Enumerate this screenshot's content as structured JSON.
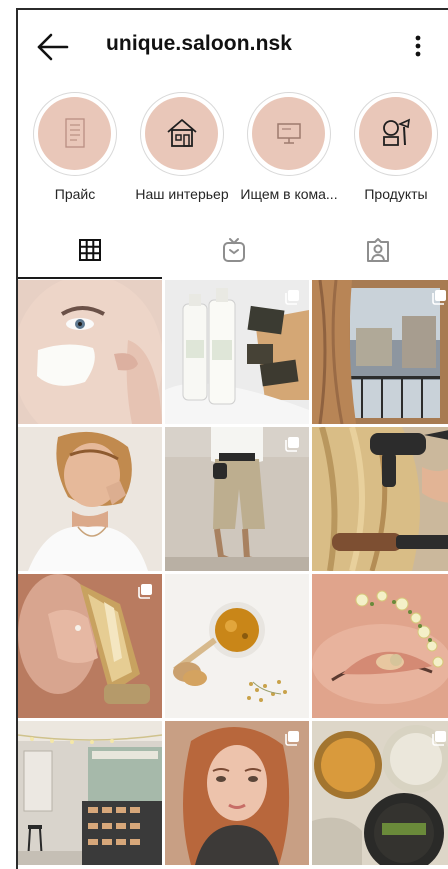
{
  "header": {
    "username": "unique.saloon.nsk"
  },
  "highlights": [
    {
      "label": "Прайс",
      "icon": "price-list-icon"
    },
    {
      "label": "Наш интерьер",
      "icon": "house-icon"
    },
    {
      "label": "Ищем в кома...",
      "icon": "monitor-icon"
    },
    {
      "label": "Продукты",
      "icon": "cosmetics-icon"
    }
  ],
  "tabs": [
    {
      "name": "posts-grid-tab",
      "icon": "grid-icon",
      "active": true
    },
    {
      "name": "igtv-tab",
      "icon": "igtv-icon",
      "active": false
    },
    {
      "name": "tagged-tab",
      "icon": "tagged-user-icon",
      "active": false
    }
  ],
  "colors": {
    "highlight_fill": "#e9c7b9",
    "text": "#262626"
  },
  "posts": [
    {
      "subject": "face-cream",
      "multiple": false
    },
    {
      "subject": "product-bottles-soap",
      "multiple": true
    },
    {
      "subject": "window-curtain",
      "multiple": true
    },
    {
      "subject": "woman-portrait",
      "multiple": false
    },
    {
      "subject": "street-fashion",
      "multiple": true
    },
    {
      "subject": "hair-dryer",
      "multiple": false
    },
    {
      "subject": "serum-bottle",
      "multiple": true
    },
    {
      "subject": "honey-jar",
      "multiple": false
    },
    {
      "subject": "eye-makeup",
      "multiple": false
    },
    {
      "subject": "cafe-interior",
      "multiple": false
    },
    {
      "subject": "red-hair-portrait",
      "multiple": true
    },
    {
      "subject": "jars",
      "multiple": true
    }
  ]
}
